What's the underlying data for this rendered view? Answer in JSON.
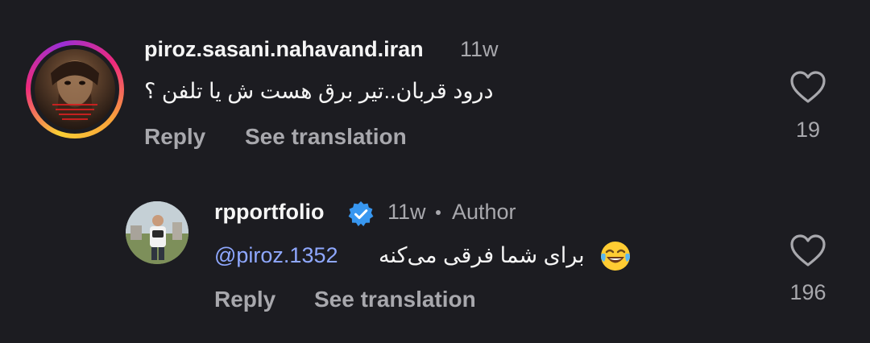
{
  "comments": [
    {
      "username": "piroz.sasani.nahavand.iran",
      "time": "11w",
      "text": "درود قربان..تیر برق هست ش یا تلفن ؟",
      "reply_label": "Reply",
      "translate_label": "See translation",
      "likes": "19",
      "avatar_icon": "profile-photo-story-ring"
    },
    {
      "username": "rpportfolio",
      "verified": true,
      "time": "11w",
      "author_badge": "Author",
      "mention": "@piroz.1352",
      "text": "برای شما فرقی می‌کنه",
      "emoji": "face-with-tears-of-joy",
      "reply_label": "Reply",
      "translate_label": "See translation",
      "likes": "196",
      "avatar_icon": "profile-photo"
    }
  ],
  "colors": {
    "background": "#1c1c21",
    "primary_text": "#f5f5f5",
    "secondary_text": "#a8a8ad",
    "mention": "#8fa8ff",
    "verified": "#3897f0"
  }
}
